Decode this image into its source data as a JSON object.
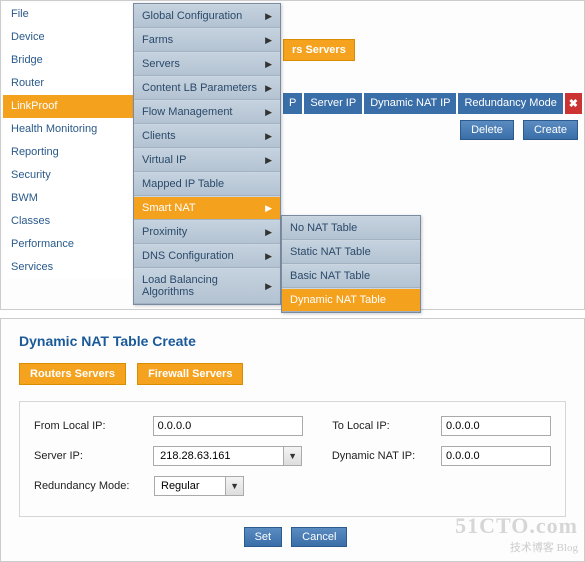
{
  "sidebar": {
    "items": [
      {
        "label": "File"
      },
      {
        "label": "Device"
      },
      {
        "label": "Bridge"
      },
      {
        "label": "Router"
      },
      {
        "label": "LinkProof"
      },
      {
        "label": "Health Monitoring"
      },
      {
        "label": "Reporting"
      },
      {
        "label": "Security"
      },
      {
        "label": "BWM"
      },
      {
        "label": "Classes"
      },
      {
        "label": "Performance"
      },
      {
        "label": "Services"
      }
    ],
    "active_index": 4
  },
  "menu": {
    "items": [
      {
        "label": "Global Configuration",
        "arrow": true
      },
      {
        "label": "Farms",
        "arrow": true
      },
      {
        "label": "Servers",
        "arrow": true
      },
      {
        "label": "Content LB Parameters",
        "arrow": true
      },
      {
        "label": "Flow Management",
        "arrow": true
      },
      {
        "label": "Clients",
        "arrow": true
      },
      {
        "label": "Virtual IP",
        "arrow": true
      },
      {
        "label": "Mapped IP Table",
        "arrow": false
      },
      {
        "label": "Smart NAT",
        "arrow": true
      },
      {
        "label": "Proximity",
        "arrow": true
      },
      {
        "label": "DNS Configuration",
        "arrow": true
      },
      {
        "label": "Load Balancing Algorithms",
        "arrow": true
      }
    ],
    "selected_index": 8
  },
  "submenu": {
    "items": [
      {
        "label": "No NAT Table"
      },
      {
        "label": "Static NAT Table"
      },
      {
        "label": "Basic NAT Table"
      },
      {
        "label": "Dynamic NAT Table"
      }
    ],
    "selected_index": 3
  },
  "bg": {
    "tag": "rs Servers",
    "cols": [
      "P",
      "Server IP",
      "Dynamic NAT IP",
      "Redundancy Mode"
    ],
    "delete_label": "Delete",
    "create_label": "Create"
  },
  "page": {
    "title": "Dynamic NAT Table Create",
    "tabs": [
      "Routers Servers",
      "Firewall Servers"
    ]
  },
  "form": {
    "from_ip_label": "From Local IP:",
    "from_ip_value": "0.0.0.0",
    "to_ip_label": "To Local IP:",
    "to_ip_value": "0.0.0.0",
    "server_ip_label": "Server IP:",
    "server_ip_value": "218.28.63.161",
    "dyn_nat_label": "Dynamic NAT IP:",
    "dyn_nat_value": "0.0.0.0",
    "redundancy_label": "Redundancy Mode:",
    "redundancy_value": "Regular",
    "set_label": "Set",
    "cancel_label": "Cancel"
  },
  "watermark": {
    "line1": "51CTO.com",
    "line2": "技术博客    Blog"
  }
}
